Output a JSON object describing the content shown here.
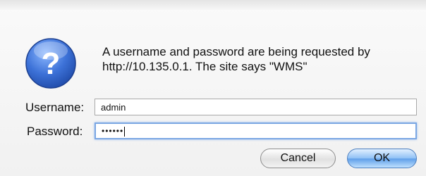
{
  "dialog": {
    "message": "A username and password are being requested by http://10.135.0.1. The site says \"WMS\"",
    "icon": "question-icon"
  },
  "form": {
    "username_label": "Username:",
    "username_value": "admin",
    "password_label": "Password:",
    "password_masked": "••••••"
  },
  "buttons": {
    "cancel_label": "Cancel",
    "ok_label": "OK"
  },
  "colors": {
    "icon_blue": "#2f63c4",
    "focus_ring": "#7ba7e3",
    "ok_button": "#5e9ee8"
  }
}
